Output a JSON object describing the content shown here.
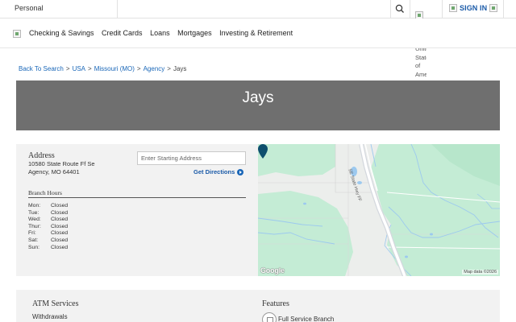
{
  "topbar": {
    "segment_label": "Personal",
    "flag_alt": "Flag of the United States of America",
    "signin_label": "SIGN IN"
  },
  "nav": {
    "items": [
      "Checking & Savings",
      "Credit Cards",
      "Loans",
      "Mortgages",
      "Investing & Retirement"
    ]
  },
  "breadcrumb": {
    "items": [
      "Back To Search",
      "USA",
      "Missouri (MO)",
      "Agency"
    ],
    "current": "Jays",
    "separator": ">"
  },
  "hero": {
    "title": "Jays"
  },
  "branch": {
    "address_heading": "Address",
    "address_line1": "10580 State Route Ff Se",
    "address_line2": "Agency, MO 64401",
    "start_placeholder": "Enter Starting Address",
    "directions_label": "Get Directions",
    "hours_heading": "Branch Hours",
    "hours": [
      {
        "day": "Mon:",
        "value": "Closed"
      },
      {
        "day": "Tue:",
        "value": "Closed"
      },
      {
        "day": "Wed:",
        "value": "Closed"
      },
      {
        "day": "Thur:",
        "value": "Closed"
      },
      {
        "day": "Fri:",
        "value": "Closed"
      },
      {
        "day": "Sat:",
        "value": "Closed"
      },
      {
        "day": "Sun:",
        "value": "Closed"
      }
    ]
  },
  "map": {
    "logo_text": "Google",
    "attribution": "Map data ©2026",
    "road_label": "SE State Hwy FF"
  },
  "services": {
    "atm_heading": "ATM Services",
    "atm_item": "Withdrawals",
    "features_heading": "Features",
    "feature_item": "Full Service Branch"
  },
  "colors": {
    "link": "#1a67b8",
    "brand_blue": "#1a5aa8",
    "hero_bg": "#6f6f6f",
    "panel_bg": "#f2f2f2",
    "map_green": "#c4ecd5",
    "map_pin": "#0e4f6e"
  }
}
